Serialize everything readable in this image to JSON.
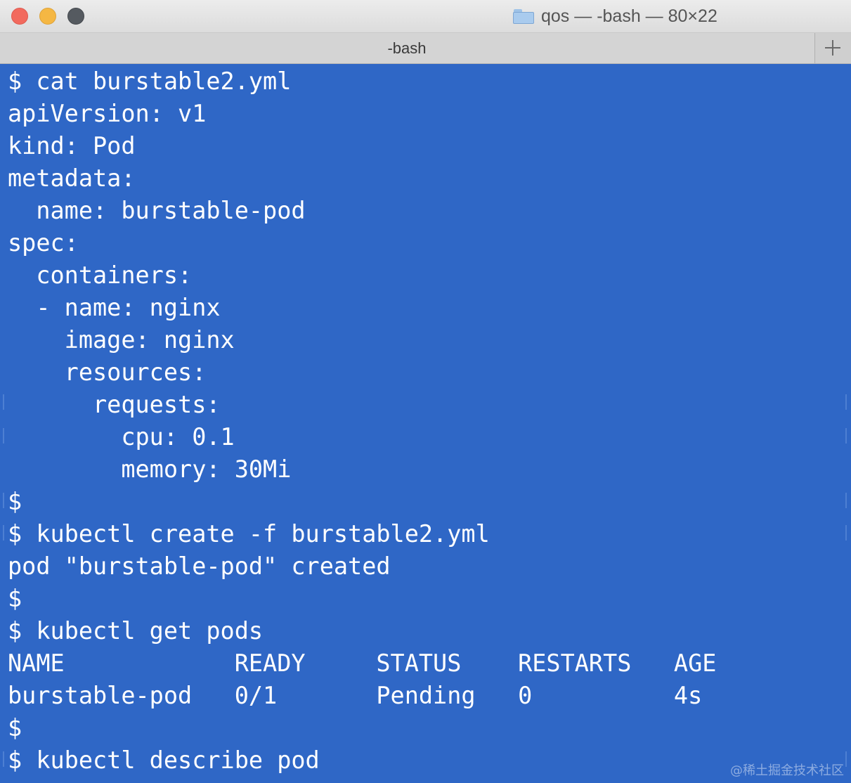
{
  "window": {
    "title": "qos — -bash — 80×22",
    "tab_label": "-bash",
    "accent": "#2f67c6",
    "text_color": "#ffffff"
  },
  "icons": {
    "title_folder": "folder-icon",
    "new_tab": "plus-icon",
    "close": "close-button",
    "minimize": "minimize-button",
    "zoom": "zoom-button"
  },
  "terminal": {
    "lines": [
      "$ cat burstable2.yml",
      "apiVersion: v1",
      "kind: Pod",
      "metadata:",
      "  name: burstable-pod",
      "spec:",
      "  containers:",
      "  - name: nginx",
      "    image: nginx",
      "    resources:",
      "      requests:",
      "        cpu: 0.1",
      "        memory: 30Mi",
      "$",
      "$ kubectl create -f burstable2.yml",
      "pod \"burstable-pod\" created",
      "$",
      "$ kubectl get pods",
      "NAME            READY     STATUS    RESTARTS   AGE",
      "burstable-pod   0/1       Pending   0          4s",
      "$",
      "$ kubectl describe pod"
    ]
  },
  "watermark": "@稀土掘金技术社区"
}
